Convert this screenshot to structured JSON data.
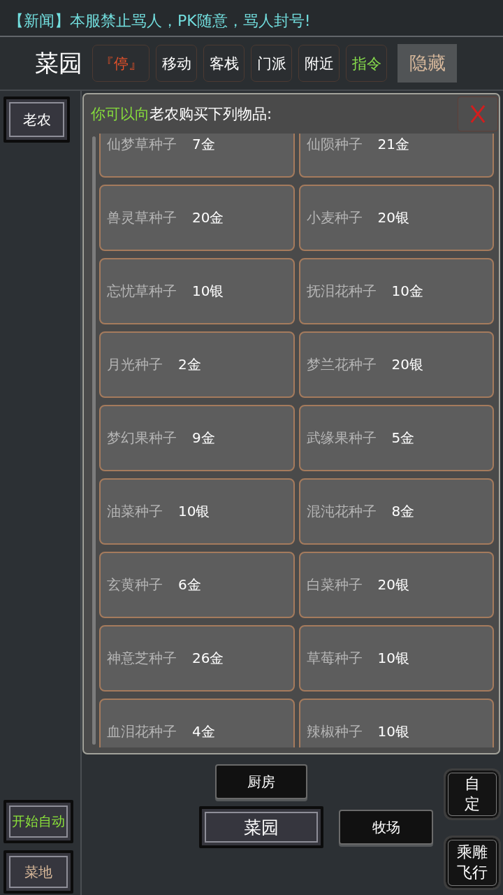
{
  "news": [
    "【新闻】本服禁止骂人，PK随意，骂人封号!"
  ],
  "location": {
    "title": "菜园"
  },
  "toolbar": [
    {
      "label": "『停』",
      "kind": "stop"
    },
    {
      "label": "移动",
      "kind": "normal"
    },
    {
      "label": "客栈",
      "kind": "normal"
    },
    {
      "label": "门派",
      "kind": "normal"
    },
    {
      "label": "附近",
      "kind": "normal"
    },
    {
      "label": "指令",
      "kind": "command"
    },
    {
      "label": "隐藏",
      "kind": "toggle"
    }
  ],
  "npcs": [
    {
      "label": "老农"
    }
  ],
  "shop": {
    "highlight": "你可以向",
    "text": "老农购买下列物品:",
    "items": [
      {
        "name": "仙梦草种子",
        "price": "7金"
      },
      {
        "name": "仙陨种子",
        "price": "21金"
      },
      {
        "name": "兽灵草种子",
        "price": "20金"
      },
      {
        "name": "小麦种子",
        "price": "20银"
      },
      {
        "name": "忘忧草种子",
        "price": "10银"
      },
      {
        "name": "抚泪花种子",
        "price": "10金"
      },
      {
        "name": "月光种子",
        "price": "2金"
      },
      {
        "name": "梦兰花种子",
        "price": "20银"
      },
      {
        "name": "梦幻果种子",
        "price": "9金"
      },
      {
        "name": "武缘果种子",
        "price": "5金"
      },
      {
        "name": "油菜种子",
        "price": "10银"
      },
      {
        "name": "混沌花种子",
        "price": "8金"
      },
      {
        "name": "玄黄种子",
        "price": "6金"
      },
      {
        "name": "白菜种子",
        "price": "20银"
      },
      {
        "name": "神意芝种子",
        "price": "26金"
      },
      {
        "name": "草莓种子",
        "price": "10银"
      },
      {
        "name": "血泪花种子",
        "price": "4金"
      },
      {
        "name": "辣椒种子",
        "price": "10银"
      }
    ]
  },
  "side_actions": [
    {
      "label": "开始自动",
      "kind": "auto"
    },
    {
      "label": "菜地",
      "kind": "place"
    }
  ],
  "exits": [
    {
      "label": "厨房",
      "kind": "north"
    },
    {
      "label": "菜园",
      "kind": "center"
    },
    {
      "label": "牧场",
      "kind": "east"
    }
  ],
  "quick_actions": [
    {
      "label": "自定"
    },
    {
      "label": "乘雕飞行"
    }
  ]
}
